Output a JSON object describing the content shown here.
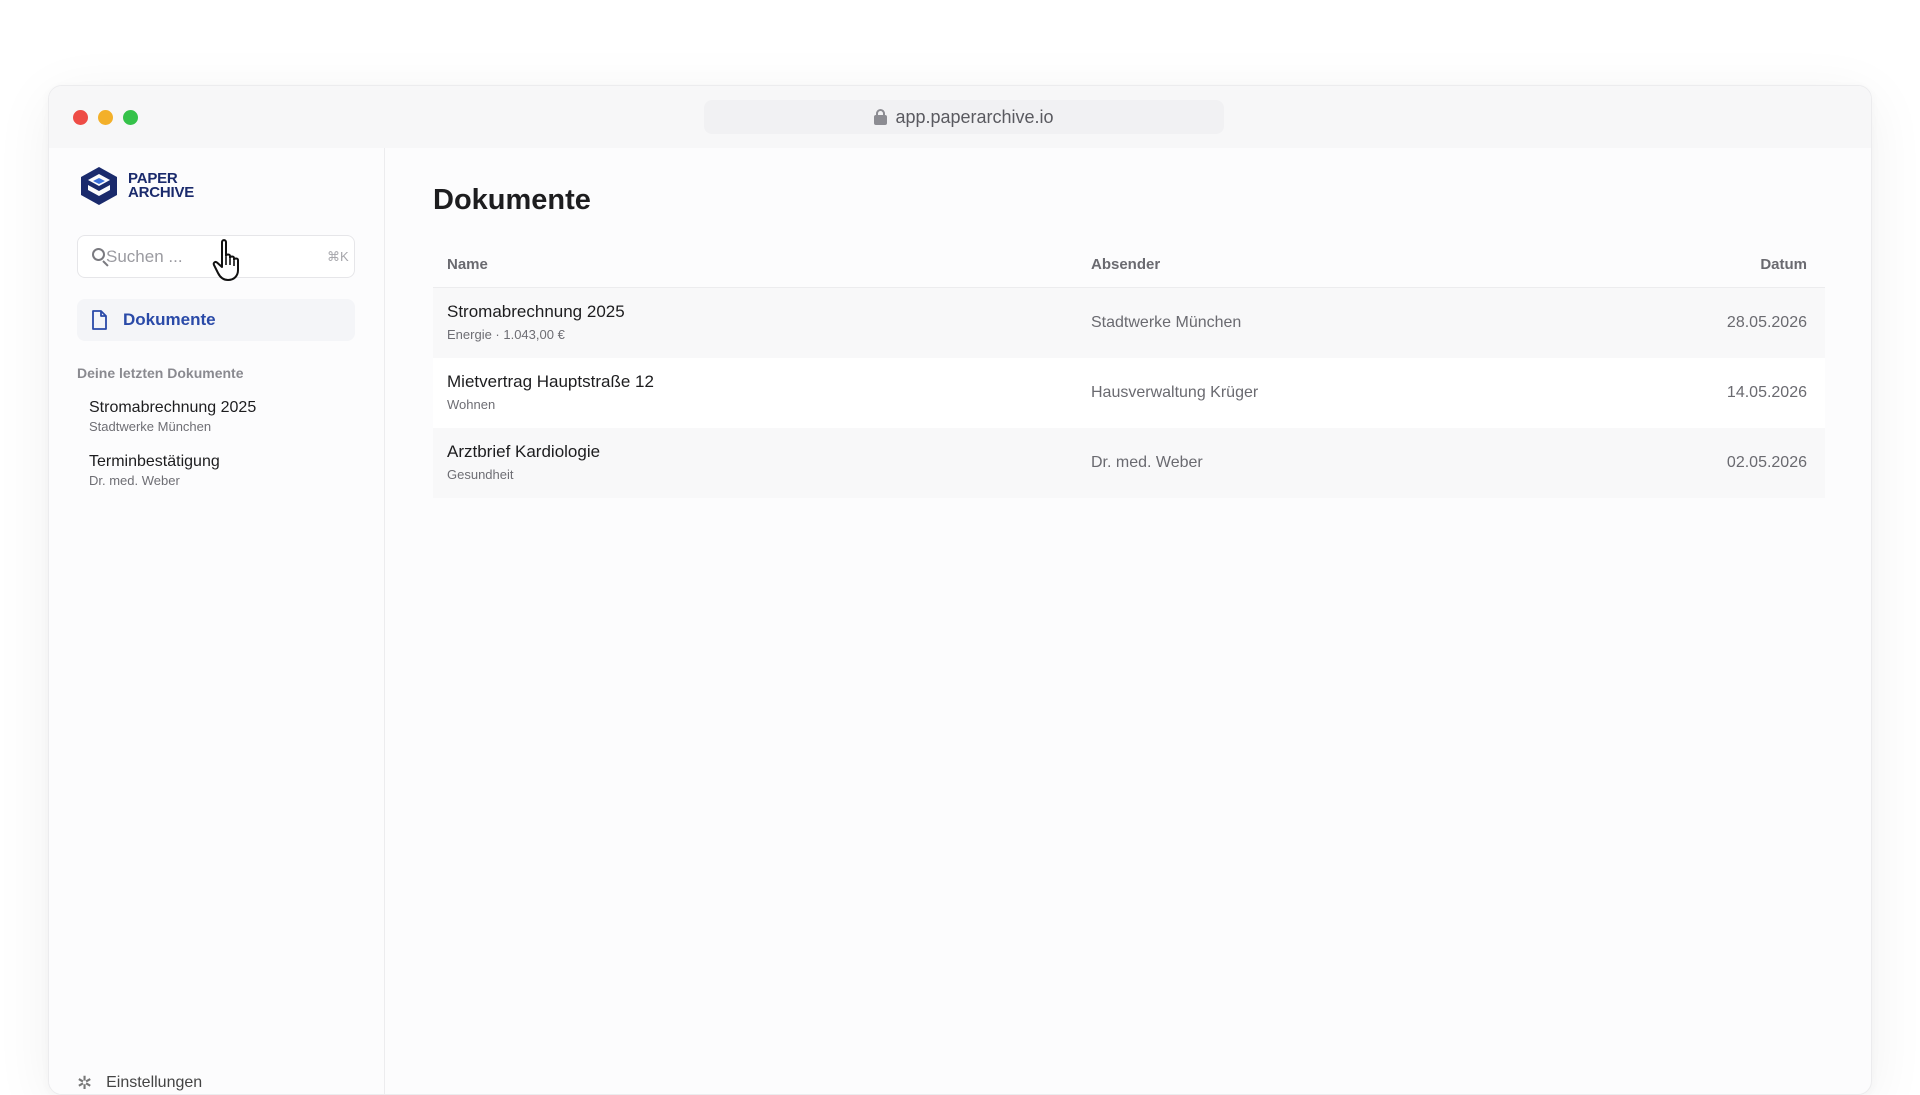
{
  "browser": {
    "url": "app.paperarchive.io"
  },
  "sidebar": {
    "logo_line1": "PAPER",
    "logo_line2": "ARCHIVE",
    "search_placeholder": "Suchen ...",
    "search_shortcut": "⌘K",
    "nav": [
      {
        "label": "Dokumente",
        "icon": "document-icon",
        "active": true
      }
    ],
    "recent_heading": "Deine letzten Dokumente",
    "recent": [
      {
        "title": "Stromabrechnung 2025",
        "subtitle": "Stadtwerke München"
      },
      {
        "title": "Terminbestätigung",
        "subtitle": "Dr. med. Weber"
      }
    ],
    "settings_label": "Einstellungen"
  },
  "main": {
    "title": "Dokumente",
    "columns": {
      "name": "Name",
      "sender": "Absender",
      "date": "Datum"
    },
    "rows": [
      {
        "title": "Stromabrechnung 2025",
        "meta": "Energie · 1.043,00 €",
        "sender": "Stadtwerke München",
        "date": "28.05.2026"
      },
      {
        "title": "Mietvertrag Hauptstraße 12",
        "meta": "Wohnen",
        "sender": "Hausverwaltung Krüger",
        "date": "14.05.2026"
      },
      {
        "title": "Arztbrief Kardiologie",
        "meta": "Gesundheit",
        "sender": "Dr. med. Weber",
        "date": "02.05.2026"
      }
    ]
  },
  "colors": {
    "accent": "#2a4aa8",
    "logo": "#1a2a6c"
  }
}
